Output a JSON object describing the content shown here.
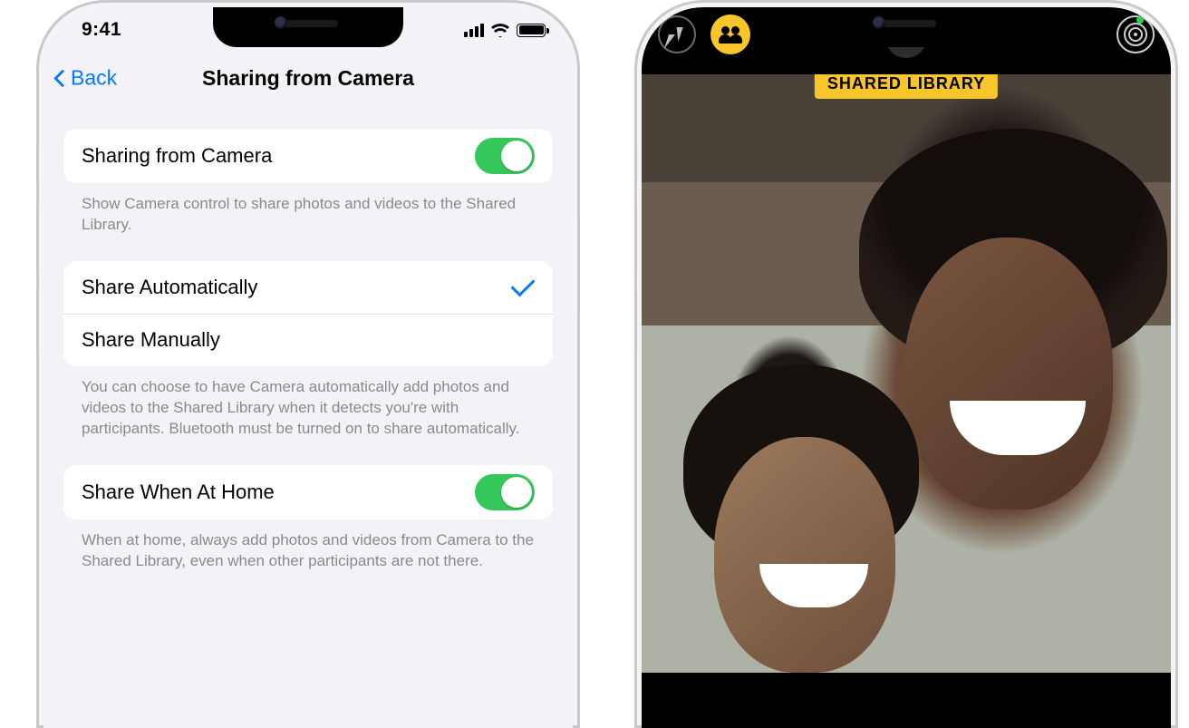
{
  "status": {
    "time": "9:41"
  },
  "settings": {
    "back_label": "Back",
    "title": "Sharing from Camera",
    "group1": {
      "row_label": "Sharing from Camera",
      "toggle_on": true,
      "footer": "Show Camera control to share photos and videos to the Shared Library."
    },
    "group2": {
      "option_auto": "Share Automatically",
      "option_auto_selected": true,
      "option_manual": "Share Manually",
      "footer": "You can choose to have Camera automatically add photos and videos to the Shared Library when it detects you're with participants. Bluetooth must be turned on to share automatically."
    },
    "group3": {
      "row_label": "Share When At Home",
      "toggle_on": true,
      "footer": "When at home, always add photos and videos from Camera to the Shared Library, even when other participants are not there."
    }
  },
  "camera": {
    "shared_badge": "SHARED LIBRARY"
  }
}
